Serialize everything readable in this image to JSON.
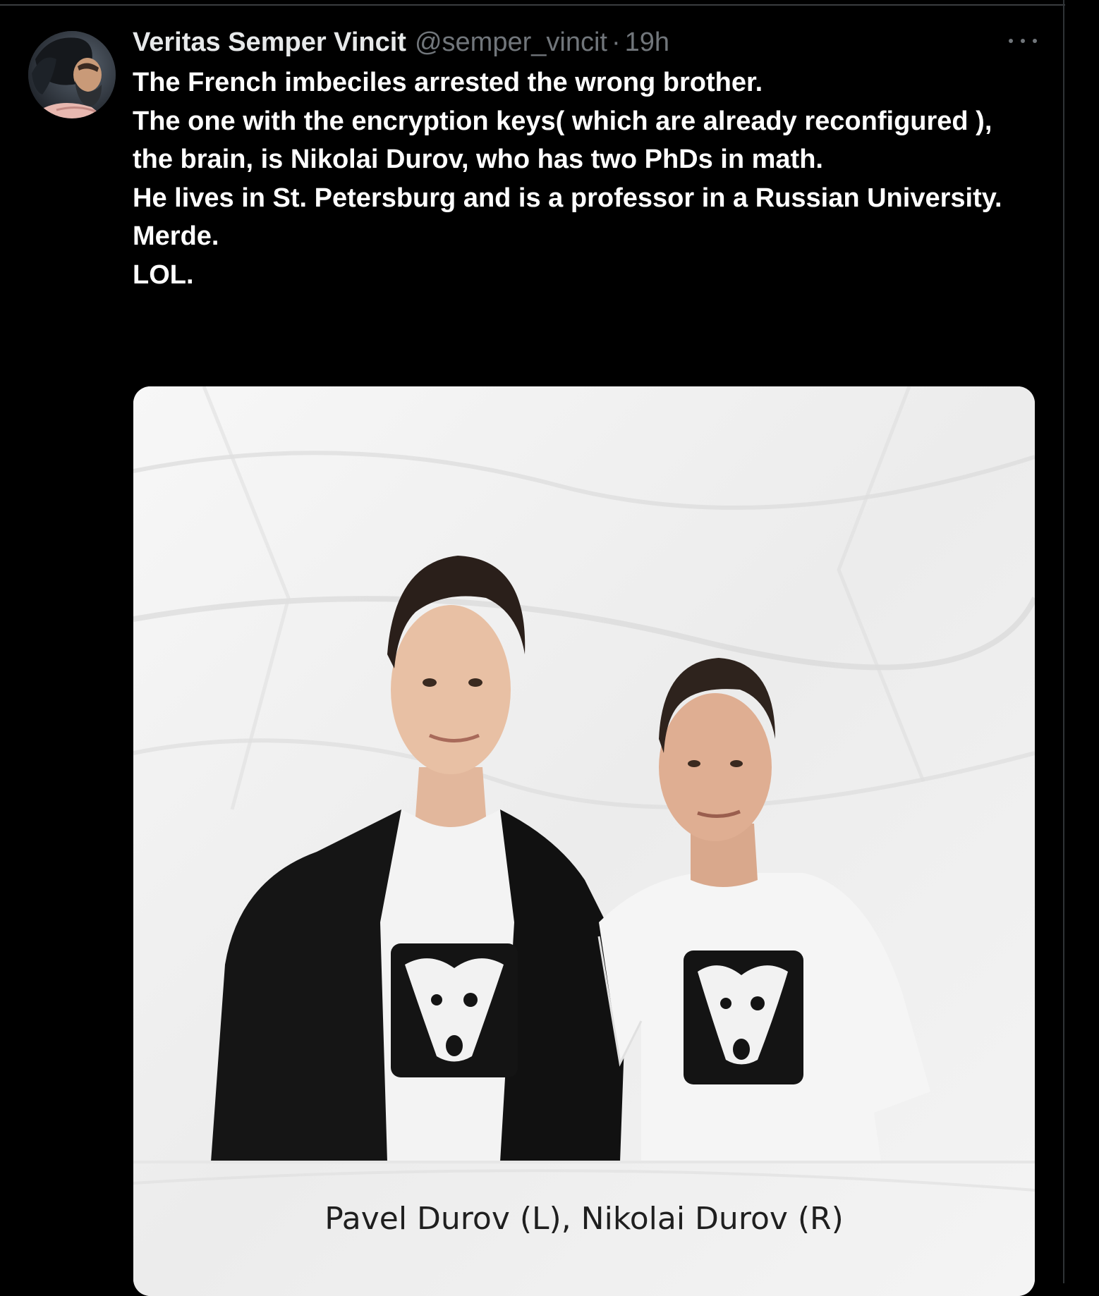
{
  "tweet": {
    "display_name": "Veritas Semper Vincit",
    "handle": "@semper_vincit",
    "separator": "·",
    "timestamp": "19h",
    "avatar_icon": "bearded-man-painting-avatar",
    "more_icon": "more-horizontal-icon",
    "body_lines": [
      "The French imbeciles arrested the wrong brother.",
      "The one with the encryption keys( which are already reconfigured ), the brain, is Nikolai Durov, who has two PhDs in math.",
      "He lives in St. Petersburg and is a professor in a Russian University.",
      "Merde.",
      "LOL."
    ],
    "media": {
      "caption": "Pavel Durov (L), Nikolai Durov (R)",
      "shirt_logo_icon": "dog-face-logo-icon"
    }
  },
  "colors": {
    "background": "#000000",
    "text_primary": "#e7e9ea",
    "text_secondary": "#71767b",
    "divider": "#2f3336"
  }
}
